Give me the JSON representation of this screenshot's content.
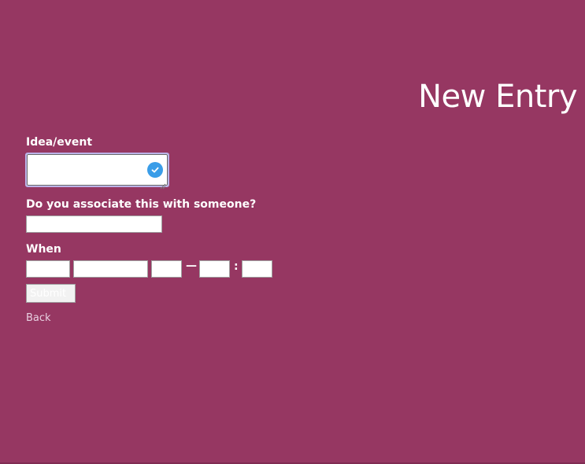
{
  "page": {
    "title": "New Entry",
    "background_color": "#963762"
  },
  "form": {
    "idea_label": "Idea/event",
    "idea_value": "",
    "associate_label": "Do you associate this with someone?",
    "associate_value": "",
    "when_label": "When",
    "when": {
      "day_value": "",
      "month_value": "",
      "year_value": "",
      "dash": "—",
      "hour_value": "",
      "colon": ":",
      "minute_value": ""
    },
    "submit_label": "Submit",
    "back_label": "Back"
  },
  "icons": {
    "validation": "check-circle-icon",
    "validation_color": "#3a9de8"
  }
}
